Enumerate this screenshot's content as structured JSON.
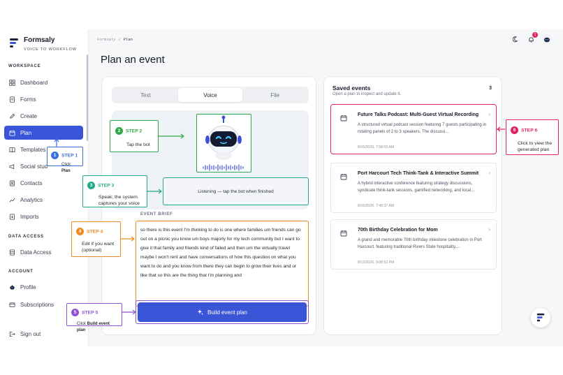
{
  "brand": {
    "name": "Formsaly",
    "tagline": "VOICE TO WORKFLOW"
  },
  "sidebar": {
    "sections": {
      "workspace": "WORKSPACE",
      "data_access": "DATA ACCESS",
      "account": "ACCOUNT"
    },
    "items": [
      {
        "label": "Dashboard",
        "icon": "dashboard-icon"
      },
      {
        "label": "Forms",
        "icon": "forms-icon"
      },
      {
        "label": "Create",
        "icon": "pen-icon"
      },
      {
        "label": "Plan",
        "icon": "calendar-icon",
        "active": true
      },
      {
        "label": "Templates",
        "icon": "book-icon"
      },
      {
        "label": "Social stud",
        "icon": "megaphone-icon"
      },
      {
        "label": "Contacts",
        "icon": "contacts-icon"
      },
      {
        "label": "Analytics",
        "icon": "chart-icon"
      },
      {
        "label": "Imports",
        "icon": "import-icon"
      },
      {
        "label": "Data Access",
        "icon": "database-icon"
      },
      {
        "label": "Profile",
        "icon": "bot-icon"
      },
      {
        "label": "Subscriptions",
        "icon": "card-icon"
      },
      {
        "label": "Sign out",
        "icon": "sign-out-icon"
      }
    ]
  },
  "topbar": {
    "breadcrumb": [
      "Formsaly",
      "Plan"
    ],
    "breadcrumb_sep": "/",
    "notification_count": "1"
  },
  "page": {
    "title": "Plan an event"
  },
  "tabs": [
    {
      "label": "Text"
    },
    {
      "label": "Voice",
      "active": true
    },
    {
      "label": "File"
    }
  ],
  "voice": {
    "status": "Listening — tap the bot when finished"
  },
  "brief": {
    "label": "EVENT BRIEF",
    "text": "so there is this event I'm thinking to do is one where families um friends can go out on a picnic you know um boys majorly for my tech community but I want to give it that family and friends kind of failed and then um the virtually travel maybe I won't rent and have conversations of how this question on what you want to do and you know from there they can begin to grow their lives and or like that so this are the thing that I'm planning and"
  },
  "build_button": {
    "label": "Build event plan"
  },
  "saved": {
    "title": "Saved events",
    "subtitle": "Open a plan to inspect and update it.",
    "count": "3",
    "events": [
      {
        "title": "Future Talks Podcast: Multi-Guest Virtual Recording",
        "description": "A structured virtual podcast session featuring 7 guests participating in rotating panels of 2 to 3 speakers. The discussi...",
        "date": "8/16/2026, 7:58:03 AM"
      },
      {
        "title": "Port Harcourt Tech Think-Tank & Interactive Summit",
        "description": "A hybrid interactive conference featuring strategy discussions, syndicate think-tank sessions, gamified networking, and local...",
        "date": "8/16/2026, 7:48:37 AM"
      },
      {
        "title": "70th Birthday Celebration for Mom",
        "description": "A grand and memorable 70th birthday milestone celebration in Port Harcourt, featuring traditional Rivers State hospitality,...",
        "date": "8/12/2026, 9:08:52 PM"
      }
    ]
  },
  "callouts": {
    "step1": {
      "num": "1",
      "label": "STEP 1",
      "text_pre": "Click ",
      "text_bold": "Plan"
    },
    "step2": {
      "num": "2",
      "label": "STEP 2",
      "text": "Tap the bot"
    },
    "step3": {
      "num": "3",
      "label": "STEP 3",
      "text": "Speak; the system captures your voice"
    },
    "step4": {
      "num": "4",
      "label": "STEP 4",
      "text": "Edit if you want (optional)"
    },
    "step5": {
      "num": "5",
      "label": "STEP 5",
      "text_pre": "Click ",
      "text_bold": "Build event plan"
    },
    "step6": {
      "num": "6",
      "label": "STEP 6",
      "text": "Click to view the generated plan"
    }
  },
  "colors": {
    "accent": "#3b55d9",
    "step_green": "#2ea84a",
    "step_teal": "#22a88a",
    "step_blue": "#3b6fd9",
    "step_orange": "#f08a24",
    "step_purple": "#8f52d6",
    "step_pink": "#e0245e"
  }
}
